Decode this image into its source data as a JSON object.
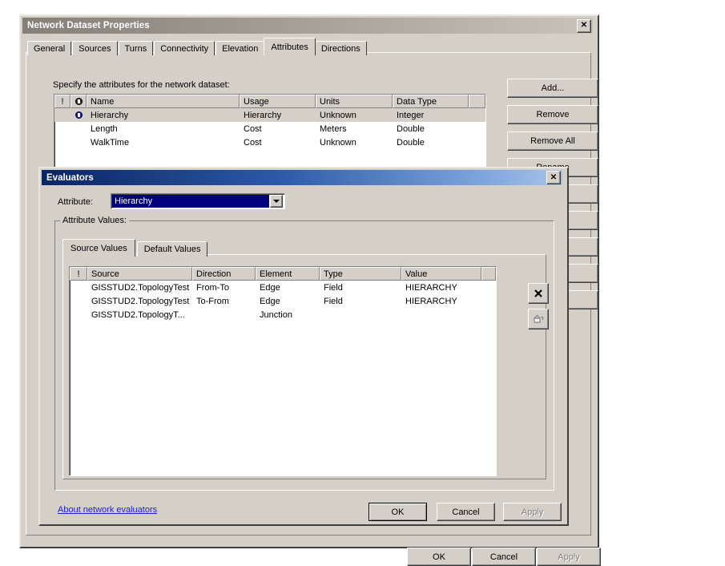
{
  "outer_window": {
    "title": "Network Dataset Properties",
    "close_icon": "✕",
    "tabs": [
      {
        "label": "General",
        "active": false
      },
      {
        "label": "Sources",
        "active": false
      },
      {
        "label": "Turns",
        "active": false
      },
      {
        "label": "Connectivity",
        "active": false
      },
      {
        "label": "Elevation",
        "active": false
      },
      {
        "label": "Attributes",
        "active": true
      },
      {
        "label": "Directions",
        "active": false
      }
    ],
    "instruction": "Specify the attributes for the network dataset:",
    "attributes_list": {
      "columns": [
        "!",
        "ⓞ",
        "Name",
        "Usage",
        "Units",
        "Data Type",
        ""
      ],
      "rows": [
        {
          "flag": "",
          "icon": "hierarchy-glyph",
          "name": "Hierarchy",
          "usage": "Hierarchy",
          "units": "Unknown",
          "data_type": "Integer",
          "selected": true
        },
        {
          "flag": "",
          "icon": "",
          "name": "Length",
          "usage": "Cost",
          "units": "Meters",
          "data_type": "Double",
          "selected": false
        },
        {
          "flag": "",
          "icon": "",
          "name": "WalkTime",
          "usage": "Cost",
          "units": "Unknown",
          "data_type": "Double",
          "selected": false
        }
      ]
    },
    "side_buttons": [
      {
        "label": "Add...",
        "enabled": true
      },
      {
        "label": "Remove",
        "enabled": true
      },
      {
        "label": "Remove All",
        "enabled": true
      },
      {
        "label": "Rename",
        "enabled": true
      }
    ],
    "bottom_buttons": [
      {
        "label": "OK",
        "enabled": true
      },
      {
        "label": "Cancel",
        "enabled": true
      },
      {
        "label": "Apply",
        "enabled": false
      }
    ]
  },
  "evaluators_dialog": {
    "title": "Evaluators",
    "close_icon": "✕",
    "attribute_label": "Attribute:",
    "attribute_value": "Hierarchy",
    "group_title": "Attribute Values:",
    "tabs": [
      {
        "label": "Source Values",
        "active": true
      },
      {
        "label": "Default Values",
        "active": false
      }
    ],
    "source_values_list": {
      "columns": [
        "!",
        "Source",
        "Direction",
        "Element",
        "Type",
        "Value",
        ""
      ],
      "rows": [
        {
          "flag": "",
          "source": "GISSTUD2.TopologyTest",
          "direction": "From-To",
          "element": "Edge",
          "type": "Field",
          "value": "HIERARCHY"
        },
        {
          "flag": "",
          "source": "GISSTUD2.TopologyTest",
          "direction": "To-From",
          "element": "Edge",
          "type": "Field",
          "value": "HIERARCHY"
        },
        {
          "flag": "",
          "source": "GISSTUD2.TopologyT...",
          "direction": "",
          "element": "Junction",
          "type": "",
          "value": ""
        }
      ]
    },
    "tool_buttons": [
      {
        "name": "delete",
        "glyph": "✖",
        "enabled": true
      },
      {
        "name": "fill",
        "glyph": "bucket",
        "enabled": false
      }
    ],
    "about_link": "About network evaluators",
    "bottom_buttons": [
      {
        "label": "OK",
        "enabled": true,
        "default": true
      },
      {
        "label": "Cancel",
        "enabled": true,
        "default": false
      },
      {
        "label": "Apply",
        "enabled": false,
        "default": false
      }
    ]
  },
  "colors": {
    "face": "#d4d0c8",
    "active_title_start": "#0a2464",
    "active_title_end": "#a8c4e8",
    "inactive_title": "#848078",
    "selection": "#000080",
    "link": "#2222cc"
  }
}
